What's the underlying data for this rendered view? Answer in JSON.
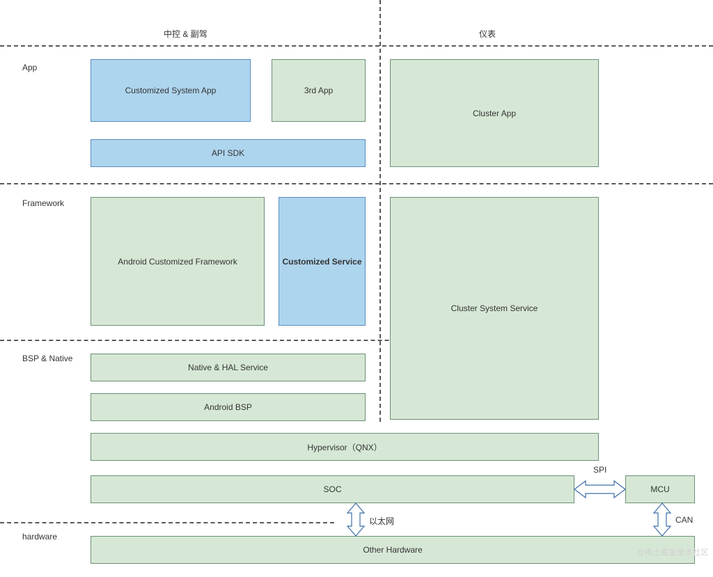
{
  "headers": {
    "left": "中控 & 副驾",
    "right": "仪表"
  },
  "layers": {
    "app": "App",
    "framework": "Framework",
    "bsp_native": "BSP & Native",
    "hardware": "hardware"
  },
  "blocks": {
    "customized_system_app": "Customized System App",
    "third_app": "3rd App",
    "api_sdk": "API SDK",
    "cluster_app": "Cluster App",
    "android_customized_framework": "Android Customized Framework",
    "customized_service": "Customized Service",
    "cluster_system_service": "Cluster System Service",
    "native_hal_service": "Native & HAL Service",
    "android_bsp": "Android BSP",
    "hypervisor": "Hypervisor（QNX）",
    "soc": "SOC",
    "mcu": "MCU",
    "other_hardware": "Other Hardware"
  },
  "connectors": {
    "spi": "SPI",
    "ethernet": "以太网",
    "can": "CAN"
  },
  "watermark": "@稀土掘金技术社区"
}
